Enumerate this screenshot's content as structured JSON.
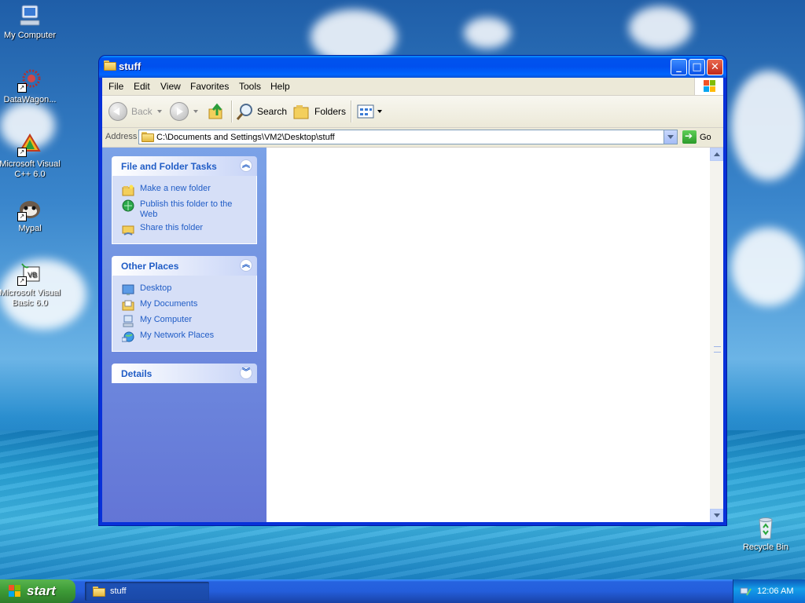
{
  "desktop": {
    "icons": [
      {
        "label": "My Computer"
      },
      {
        "label": "DataWagon..."
      },
      {
        "label": "Microsoft Visual C++ 6.0"
      },
      {
        "label": "Mypal"
      },
      {
        "label": "Microsoft Visual Basic 6.0"
      },
      {
        "label": "Recycle Bin"
      }
    ]
  },
  "window": {
    "title": "stuff",
    "menu": [
      "File",
      "Edit",
      "View",
      "Favorites",
      "Tools",
      "Help"
    ],
    "toolbar": {
      "back_label": "Back",
      "search_label": "Search",
      "folders_label": "Folders"
    },
    "address": {
      "label": "Address",
      "value": "C:\\Documents and Settings\\VM2\\Desktop\\stuff",
      "go_label": "Go"
    },
    "panels": {
      "file_tasks": {
        "title": "File and Folder Tasks",
        "items": [
          {
            "label": "Make a new folder",
            "icon": "new-folder-icon"
          },
          {
            "label": "Publish this folder to the Web",
            "icon": "publish-web-icon"
          },
          {
            "label": "Share this folder",
            "icon": "share-folder-icon"
          }
        ]
      },
      "other_places": {
        "title": "Other Places",
        "items": [
          {
            "label": "Desktop",
            "icon": "desktop-icon"
          },
          {
            "label": "My Documents",
            "icon": "my-documents-icon"
          },
          {
            "label": "My Computer",
            "icon": "my-computer-icon"
          },
          {
            "label": "My Network Places",
            "icon": "network-places-icon"
          }
        ]
      },
      "details": {
        "title": "Details"
      }
    }
  },
  "taskbar": {
    "start_label": "start",
    "task_item_label": "stuff",
    "clock": "12:06 AM"
  },
  "colors": {
    "title_bar": "#0053ee",
    "task_link": "#215dc6",
    "start_green": "#3c9a36"
  }
}
